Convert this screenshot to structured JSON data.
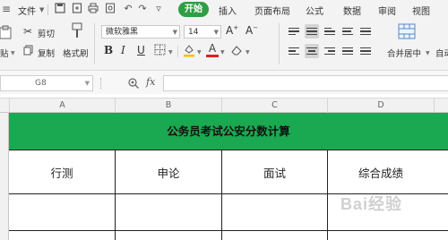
{
  "menubar": {
    "file": "文件",
    "tabs": [
      {
        "label": "开始",
        "active": true
      },
      {
        "label": "插入"
      },
      {
        "label": "页面布局"
      },
      {
        "label": "公式"
      },
      {
        "label": "数据"
      },
      {
        "label": "审阅"
      },
      {
        "label": "视图"
      }
    ]
  },
  "ribbon": {
    "cut": "剪切",
    "copy": "复制",
    "format_painter": "格式刷",
    "paste_partial": "贴",
    "font_name": "微软雅黑",
    "font_size": "14",
    "bold": "B",
    "italic": "I",
    "underline": "U",
    "font_color_glyph": "A",
    "merge_center": "合并居中",
    "auto_partial": "自动"
  },
  "formula_bar": {
    "cell_ref": "G8",
    "fx": "fx",
    "value": ""
  },
  "grid": {
    "columns": [
      "A",
      "B",
      "C",
      "D"
    ],
    "title": "公务员考试公安分数计算",
    "headers": [
      "行测",
      "申论",
      "面试",
      "综合成绩"
    ],
    "title_fill_color": "#1aa851"
  },
  "watermark": "Bai经验"
}
